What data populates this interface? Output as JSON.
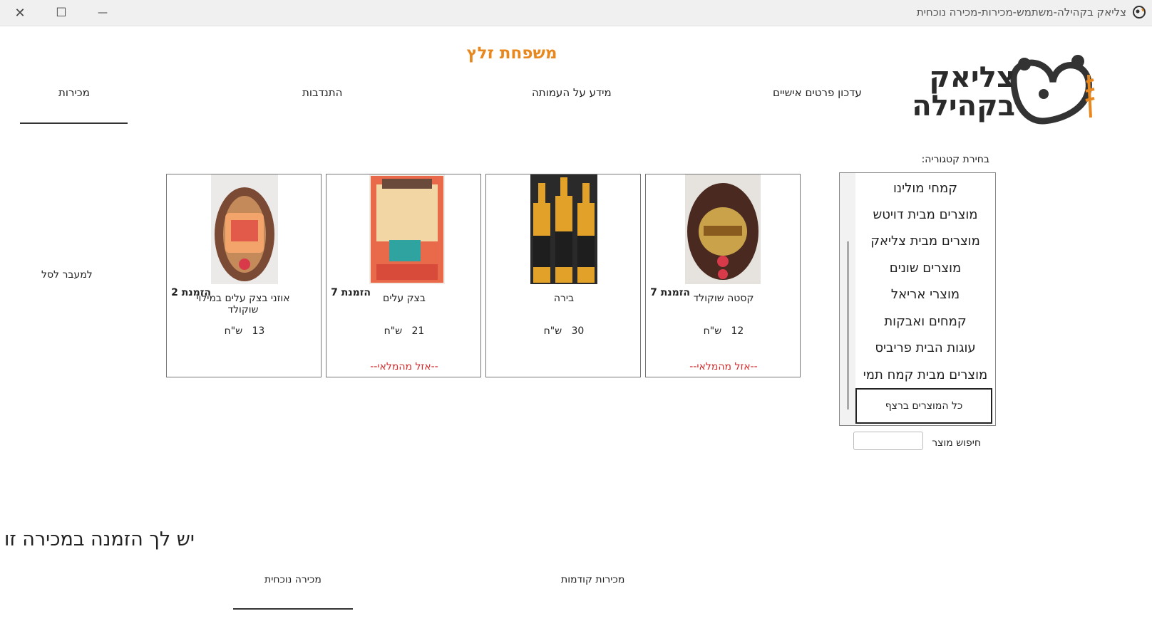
{
  "window": {
    "title": "צליאק בקהילה-משתמש-מכירות-מכירה נוכחית",
    "close_glyph": "✕",
    "maximize_glyph": "☐",
    "minimize_glyph": "—"
  },
  "header": {
    "family_name": "משפחת זלץ",
    "logo_line1": "צליאק",
    "logo_line2": "בקהילה"
  },
  "nav": {
    "sales": "מכירות",
    "donations": "התנדבות",
    "association_info": "מידע על העמותה",
    "update_details": "עדכון פרטים אישיים"
  },
  "categories": {
    "label": "בחירת קטגוריה:",
    "items": [
      "קמחי מולינו",
      "מוצרים מבית דויטש",
      "מוצרים מבית צליאק",
      "מוצרים שונים",
      "מוצרי אריאל",
      "קמחים ואבקות",
      "עוגות הבית פריביס",
      "מוצרים מבית קמח תמי"
    ],
    "all_products": "כל המוצרים ברצף"
  },
  "search": {
    "label": "חיפוש מוצר",
    "placeholder": ""
  },
  "products": [
    {
      "name": "קסטה שוקולד",
      "order": "הזמנת 7",
      "price": "12",
      "currency": "ש\"ח",
      "stock": "--אזל מהמלאי--"
    },
    {
      "name": "בירה",
      "order": "",
      "price": "30",
      "currency": "ש\"ח",
      "stock": ""
    },
    {
      "name": "בצק עלים",
      "order": "הזמנת 7",
      "price": "21",
      "currency": "ש\"ח",
      "stock": "--אזל מהמלאי--"
    },
    {
      "name": "אוזני בצק עלים במילוי שוקולד",
      "order": "הזמנת 2",
      "price": "13",
      "currency": "ש\"ח",
      "stock": ""
    }
  ],
  "cart_link": "למעבר לסל",
  "notice": "יש לך הזמנה במכירה זו",
  "bottom_tabs": {
    "current_sale": "מכירה נוכחית",
    "previous_sales": "מכירות קודמות"
  },
  "colors": {
    "accent_orange": "#e8871e",
    "stock_red": "#d42a2a"
  }
}
